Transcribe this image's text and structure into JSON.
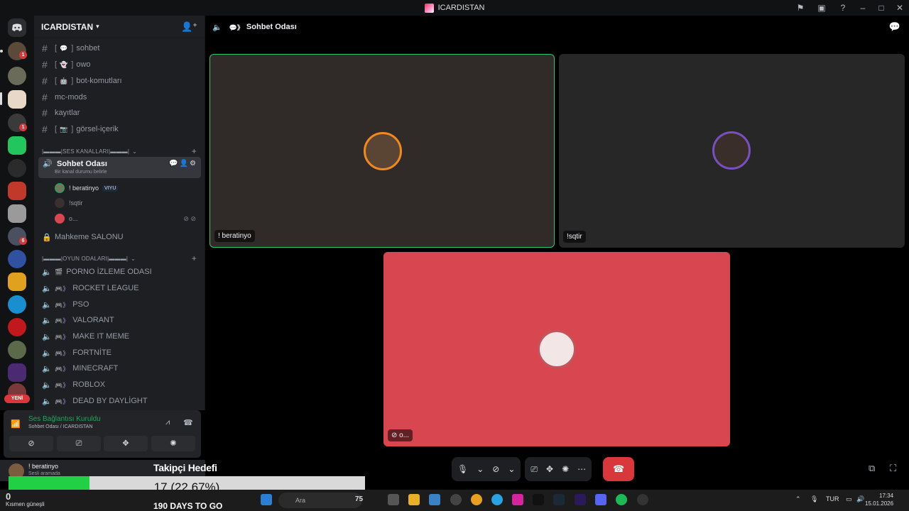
{
  "window": {
    "title": "ICARDISTAN"
  },
  "server": {
    "name": "ICARDISTAN",
    "badges": [
      "1",
      "1",
      "6"
    ],
    "new_label": "YENİ"
  },
  "channels": {
    "text": [
      {
        "emoji": "💬",
        "name": "sohbet",
        "bracketed": true
      },
      {
        "emoji": "👻",
        "name": "owo",
        "bracketed": true
      },
      {
        "emoji": "🤖",
        "name": "bot-komutları",
        "bracketed": true
      },
      {
        "emoji": "",
        "name": "mc-mods",
        "bracketed": false
      },
      {
        "emoji": "",
        "name": "kayıtlar",
        "bracketed": false
      },
      {
        "emoji": "📷",
        "name": "görsel-içerik",
        "bracketed": true
      }
    ],
    "category_voice": "|▬▬▬|SES KANALLARI|▬▬▬|",
    "active_voice": {
      "name": "Sohbet Odası",
      "status": "Bir kanal durumu belirle"
    },
    "voice_users": [
      {
        "name": "! beratinyo",
        "tag": "VIYU"
      },
      {
        "name": "!sqtir",
        "tag": ""
      },
      {
        "name": "o...",
        "tag": ""
      }
    ],
    "locked_channel": "Mahkeme SALONU",
    "category_games": "|▬▬▬|OYUN ODALARI|▬▬▬|",
    "game_channels": [
      "PORNO İZLEME ODASI",
      "ROCKET LEAGUE",
      "PSO",
      "VALORANT",
      "MAKE IT MEME",
      "FORTNİTE",
      "MINECRAFT",
      "ROBLOX",
      "DEAD BY DAYLİGHT"
    ]
  },
  "voice_panel": {
    "status": "Ses Bağlantısı Kuruldu",
    "subtitle": "Sohbet Odası / ICARDISTAN"
  },
  "user": {
    "name": "! beratinyo",
    "status": "Sesli aramada"
  },
  "main": {
    "channel": "Sohbet Odası"
  },
  "tiles": [
    {
      "name": "! beratinyo",
      "speaking": true
    },
    {
      "name": "!sqtir",
      "speaking": false
    },
    {
      "name": "o...",
      "speaking": false
    }
  ],
  "overlay": {
    "goal_title": "Takipçi Hedefi",
    "progress_text": "17 (22.67%)",
    "progress_fraction": 0.2267,
    "days_left": "190 DAYS TO GO"
  },
  "taskbar": {
    "temperature": "0",
    "weather": "Kısmen güneşli",
    "search_placeholder": "Ara",
    "badge": "75",
    "language": "TUR",
    "time": "17:34",
    "date": "15.01.2026"
  },
  "colors": {
    "accent_green": "#23a55a",
    "end_call_red": "#da373c",
    "progress_green": "#22d046",
    "tile3_bg": "#d8474f"
  }
}
